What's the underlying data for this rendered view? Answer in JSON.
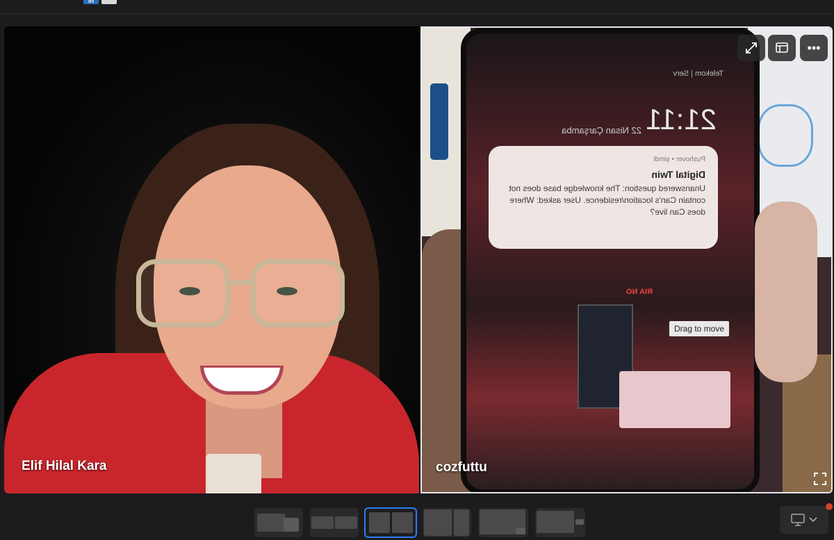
{
  "participants": [
    {
      "name": "Elif Hilal Kara"
    },
    {
      "name": "cozfuttu"
    }
  ],
  "phone_screen": {
    "status": "Telekom | Serv",
    "time": "21:11",
    "date": "22 Nisan Çarşamba",
    "notification": {
      "app": "Pushover • şimdi",
      "title": "Digital Twin",
      "body": "Unanswered question: The knowledge base does not contain Can's location/residence. User asked: Where does Can live?"
    },
    "rec_label": "RIA NO"
  },
  "tooltip": "Drag to move",
  "controls": {
    "expand_icon": "expand-icon",
    "layout_icon": "layout-settings-icon",
    "more_icon": "more-options-icon",
    "more_label": "•••"
  },
  "layout_options": [
    "sidebar",
    "side-by-side-wide",
    "side-by-side",
    "split-large-left",
    "speaker",
    "speaker-thumbnail"
  ],
  "active_layout": "side-by-side",
  "colors": {
    "accent": "#2f7bf6",
    "notification_dot": "#d2452b"
  }
}
